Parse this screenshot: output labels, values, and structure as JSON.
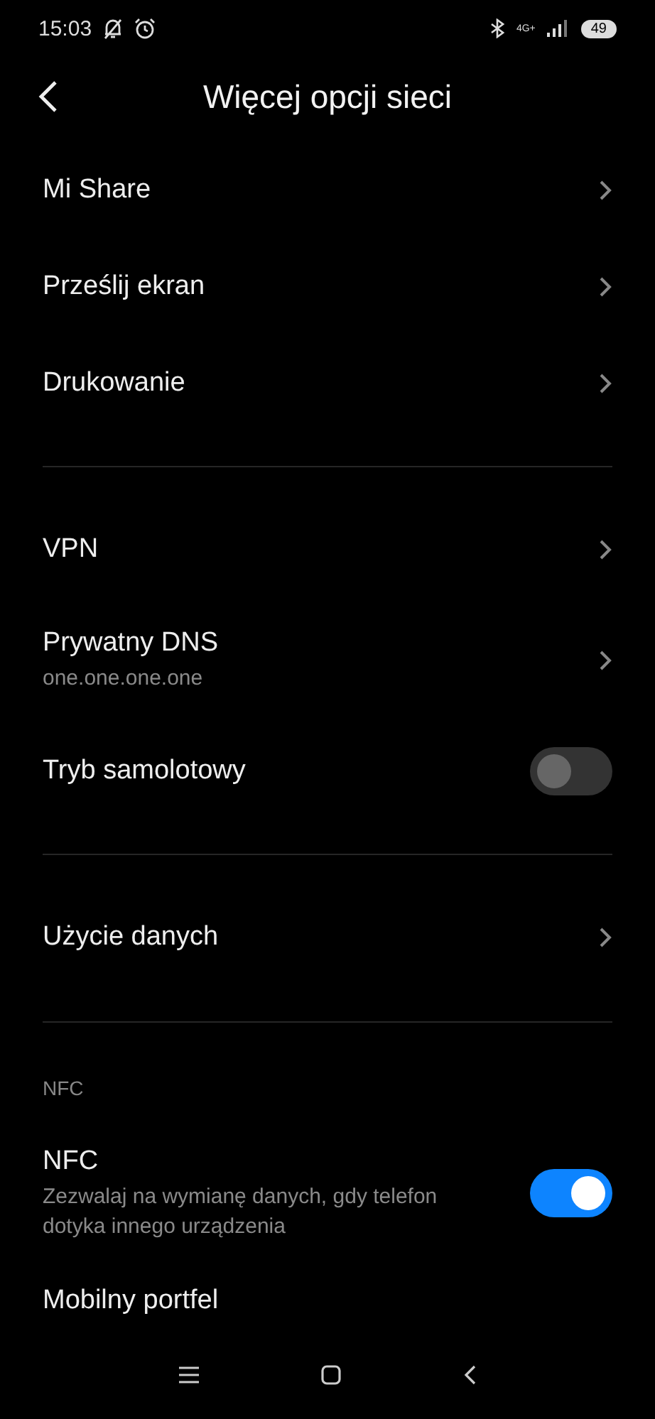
{
  "status_bar": {
    "time": "15:03",
    "network": "4G+",
    "battery": "49"
  },
  "header": {
    "title": "Więcej opcji sieci"
  },
  "items": [
    {
      "kind": "link",
      "title": "Mi Share"
    },
    {
      "kind": "link",
      "title": "Prześlij ekran"
    },
    {
      "kind": "link",
      "title": "Drukowanie"
    },
    {
      "kind": "divider"
    },
    {
      "kind": "link",
      "title": "VPN"
    },
    {
      "kind": "link",
      "title": "Prywatny DNS",
      "subtitle": "one.one.one.one"
    },
    {
      "kind": "toggle",
      "title": "Tryb samolotowy",
      "on": false
    },
    {
      "kind": "divider"
    },
    {
      "kind": "link",
      "title": "Użycie danych"
    },
    {
      "kind": "divider"
    },
    {
      "kind": "header",
      "title": "NFC"
    },
    {
      "kind": "toggle",
      "title": "NFC",
      "subtitle": "Zezwalaj na wymianę danych, gdy telefon dotyka innego urządzenia",
      "on": true
    },
    {
      "kind": "last",
      "title": "Mobilny portfel"
    }
  ]
}
